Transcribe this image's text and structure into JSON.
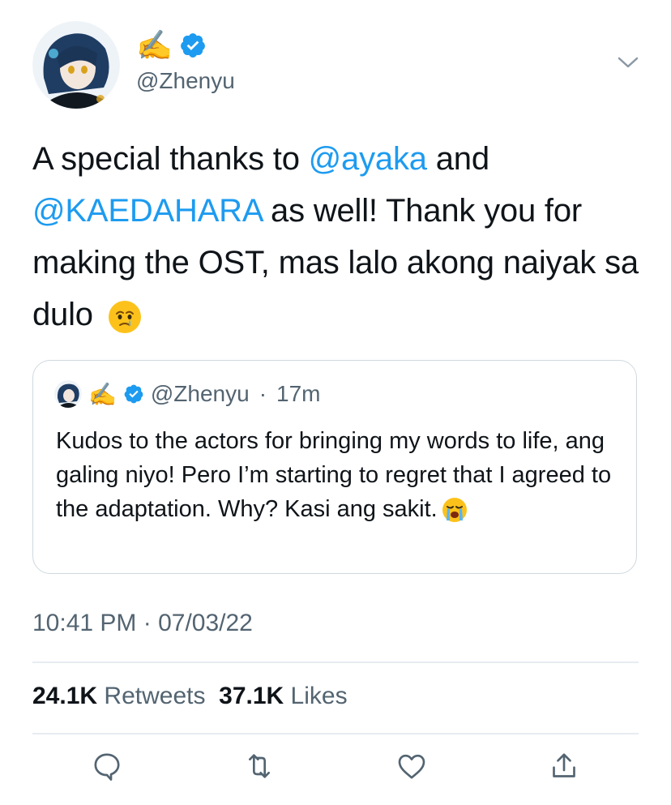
{
  "author": {
    "display_name": "✍️",
    "handle": "@Zhenyu"
  },
  "tweet": {
    "segments": [
      {
        "text": "A special thanks to ",
        "mention": false
      },
      {
        "text": "@ayaka",
        "mention": true
      },
      {
        "text": " and ",
        "mention": false
      },
      {
        "text": "@KAEDAHARA",
        "mention": true
      },
      {
        "text": " as well! Thank you for making the OST, mas lalo akong naiyak sa dulo ",
        "mention": false
      }
    ],
    "emoji": "face-holding-back-tears"
  },
  "quoted_tweet": {
    "display_name": "✍️",
    "handle": "@Zhenyu",
    "separator": "·",
    "time": "17m",
    "text": "Kudos to the actors for bringing my words to life, ang galing niyo! Pero I’m starting to regret that I agreed to the adaptation. Why? Kasi ang sakit.",
    "emoji": "loudly-crying-face"
  },
  "meta": {
    "timestamp": "10:41 PM · 07/03/22"
  },
  "stats": {
    "retweets_count": "24.1K",
    "retweets_label": "Retweets",
    "likes_count": "37.1K",
    "likes_label": "Likes"
  },
  "actions": [
    "reply-icon",
    "retweet-icon",
    "like-icon",
    "share-icon"
  ],
  "colors": {
    "mention": "#1d9bf0",
    "secondary_text": "#536471",
    "verified": "#1d9bf0",
    "border": "#cfd9de"
  }
}
